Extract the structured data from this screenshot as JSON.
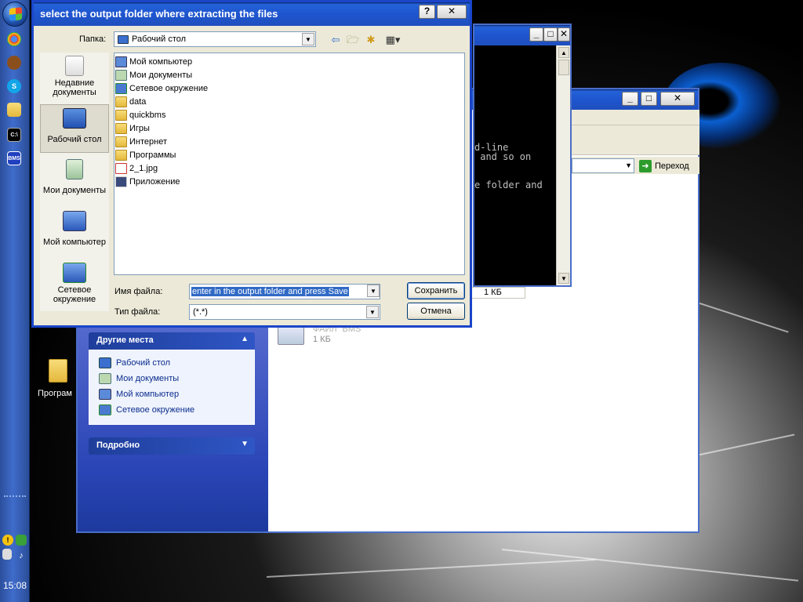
{
  "taskbar": {
    "clock": "15:08",
    "icons": [
      "start-orb",
      "chrome-icon",
      "app-icon",
      "skype-icon",
      "folder-icon",
      "cmd-icon",
      "bms-icon"
    ]
  },
  "desktop": {
    "folder_label": "Програм"
  },
  "explorer": {
    "addr_go_label": "Переход",
    "other_places_title": "Другие места",
    "other_places": [
      "Рабочий стол",
      "Мои документы",
      "Мой компьютер",
      "Сетевое окружение"
    ],
    "details_title": "Подробно",
    "file_name_fragment": "ФАЙЛ \"BMS\"",
    "file_size": "1 КБ"
  },
  "console": {
    "lines": [
      "d-line",
      " and so on",
      "",
      "",
      "e folder and"
    ],
    "file_size": "1 КБ"
  },
  "dialog": {
    "title": "select the output folder where extracting the files",
    "help_btn": "?",
    "close_btn": "✕",
    "folder_label": "Папка:",
    "folder_value": "Рабочий стол",
    "places": [
      {
        "label": "Недавние документы"
      },
      {
        "label": "Рабочий стол"
      },
      {
        "label": "Мои документы"
      },
      {
        "label": "Мой компьютер"
      },
      {
        "label": "Сетевое окружение"
      }
    ],
    "files": [
      {
        "name": "Мой компьютер",
        "icon": "computer-icon"
      },
      {
        "name": "Мои документы",
        "icon": "documents-icon"
      },
      {
        "name": "Сетевое окружение",
        "icon": "network-icon"
      },
      {
        "name": "data",
        "icon": "folder-icon"
      },
      {
        "name": "quickbms",
        "icon": "folder-icon"
      },
      {
        "name": "Игры",
        "icon": "folder-icon"
      },
      {
        "name": "Интернет",
        "icon": "folder-icon"
      },
      {
        "name": "Программы",
        "icon": "folder-icon"
      },
      {
        "name": "2_1.jpg",
        "icon": "jpg-icon"
      },
      {
        "name": "Приложение",
        "icon": "shortcut-icon"
      }
    ],
    "filename_label": "Имя файла:",
    "filename_value": "enter in the output folder and press Save",
    "filetype_label": "Тип файла:",
    "filetype_value": "(*.*)",
    "save_button": "Сохранить",
    "cancel_button": "Отмена"
  },
  "colors": {
    "titlebar_blue": "#1e55cf",
    "selection_blue": "#316ac5",
    "sidebar_blue": "#2a45b6"
  }
}
